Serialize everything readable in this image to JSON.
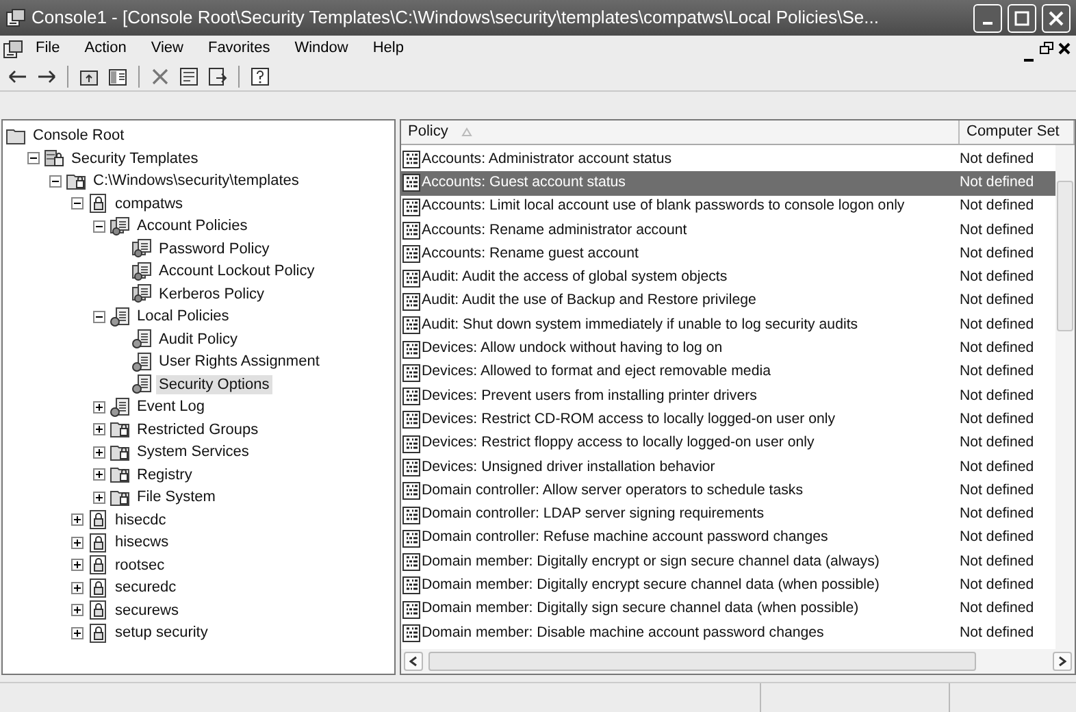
{
  "window": {
    "title": "Console1 - [Console Root\\Security Templates\\C:\\Windows\\security\\templates\\compatws\\Local Policies\\Se..."
  },
  "menu": [
    "File",
    "Action",
    "View",
    "Favorites",
    "Window",
    "Help"
  ],
  "tree": [
    {
      "label": "Console Root",
      "kind": "folder",
      "selected": false,
      "children": [
        {
          "label": "Security Templates",
          "kind": "store",
          "expanded": true,
          "selected": false,
          "children": [
            {
              "label": "C:\\Windows\\security\\templates",
              "kind": "folder-lock",
              "expanded": true,
              "selected": false,
              "children": [
                {
                  "label": "compatws",
                  "kind": "template",
                  "expanded": true,
                  "selected": false,
                  "children": [
                    {
                      "label": "Account Policies",
                      "kind": "policy",
                      "expanded": true,
                      "selected": false,
                      "children": [
                        {
                          "label": "Password Policy",
                          "kind": "policy",
                          "selected": false
                        },
                        {
                          "label": "Account Lockout Policy",
                          "kind": "policy",
                          "selected": false
                        },
                        {
                          "label": "Kerberos Policy",
                          "kind": "policy",
                          "selected": false
                        }
                      ]
                    },
                    {
                      "label": "Local Policies",
                      "kind": "policy-set",
                      "expanded": true,
                      "selected": false,
                      "children": [
                        {
                          "label": "Audit Policy",
                          "kind": "policy-set",
                          "selected": false
                        },
                        {
                          "label": "User Rights Assignment",
                          "kind": "policy-set",
                          "selected": false
                        },
                        {
                          "label": "Security Options",
                          "kind": "policy-set",
                          "selected": true
                        }
                      ]
                    },
                    {
                      "label": "Event Log",
                      "kind": "policy-set",
                      "expanded": false,
                      "selected": false
                    },
                    {
                      "label": "Restricted Groups",
                      "kind": "folder-lock",
                      "expanded": false,
                      "selected": false
                    },
                    {
                      "label": "System Services",
                      "kind": "folder-lock",
                      "expanded": false,
                      "selected": false
                    },
                    {
                      "label": "Registry",
                      "kind": "folder-lock",
                      "expanded": false,
                      "selected": false
                    },
                    {
                      "label": "File System",
                      "kind": "folder-lock",
                      "expanded": false,
                      "selected": false
                    }
                  ]
                },
                {
                  "label": "hisecdc",
                  "kind": "template",
                  "expanded": false,
                  "selected": false
                },
                {
                  "label": "hisecws",
                  "kind": "template",
                  "expanded": false,
                  "selected": false
                },
                {
                  "label": "rootsec",
                  "kind": "template",
                  "expanded": false,
                  "selected": false
                },
                {
                  "label": "securedc",
                  "kind": "template",
                  "expanded": false,
                  "selected": false
                },
                {
                  "label": "securews",
                  "kind": "template",
                  "expanded": false,
                  "selected": false
                },
                {
                  "label": "setup security",
                  "kind": "template",
                  "expanded": false,
                  "selected": false
                }
              ]
            }
          ]
        }
      ]
    }
  ],
  "table": {
    "columns": [
      "Policy",
      "Computer Set"
    ],
    "rows": [
      {
        "policy": "Accounts: Administrator account status",
        "setting": "Not defined",
        "selected": false
      },
      {
        "policy": "Accounts: Guest account status",
        "setting": "Not defined",
        "selected": true
      },
      {
        "policy": "Accounts: Limit local account use of blank passwords to console logon only",
        "setting": "Not defined",
        "selected": false
      },
      {
        "policy": "Accounts: Rename administrator account",
        "setting": "Not defined",
        "selected": false
      },
      {
        "policy": "Accounts: Rename guest account",
        "setting": "Not defined",
        "selected": false
      },
      {
        "policy": "Audit: Audit the access of global system objects",
        "setting": "Not defined",
        "selected": false
      },
      {
        "policy": "Audit: Audit the use of Backup and Restore privilege",
        "setting": "Not defined",
        "selected": false
      },
      {
        "policy": "Audit: Shut down system immediately if unable to log security audits",
        "setting": "Not defined",
        "selected": false
      },
      {
        "policy": "Devices: Allow undock without having to log on",
        "setting": "Not defined",
        "selected": false
      },
      {
        "policy": "Devices: Allowed to format and eject removable media",
        "setting": "Not defined",
        "selected": false
      },
      {
        "policy": "Devices: Prevent users from installing printer drivers",
        "setting": "Not defined",
        "selected": false
      },
      {
        "policy": "Devices: Restrict CD-ROM access to locally logged-on user only",
        "setting": "Not defined",
        "selected": false
      },
      {
        "policy": "Devices: Restrict floppy access to locally logged-on user only",
        "setting": "Not defined",
        "selected": false
      },
      {
        "policy": "Devices: Unsigned driver installation behavior",
        "setting": "Not defined",
        "selected": false
      },
      {
        "policy": "Domain controller: Allow server operators to schedule tasks",
        "setting": "Not defined",
        "selected": false
      },
      {
        "policy": "Domain controller: LDAP server signing requirements",
        "setting": "Not defined",
        "selected": false
      },
      {
        "policy": "Domain controller: Refuse machine account password changes",
        "setting": "Not defined",
        "selected": false
      },
      {
        "policy": "Domain member: Digitally encrypt or sign secure channel data (always)",
        "setting": "Not defined",
        "selected": false
      },
      {
        "policy": "Domain member: Digitally encrypt secure channel data (when possible)",
        "setting": "Not defined",
        "selected": false
      },
      {
        "policy": "Domain member: Digitally sign secure channel data (when possible)",
        "setting": "Not defined",
        "selected": false
      },
      {
        "policy": "Domain member: Disable machine account password changes",
        "setting": "Not defined",
        "selected": false
      }
    ]
  }
}
